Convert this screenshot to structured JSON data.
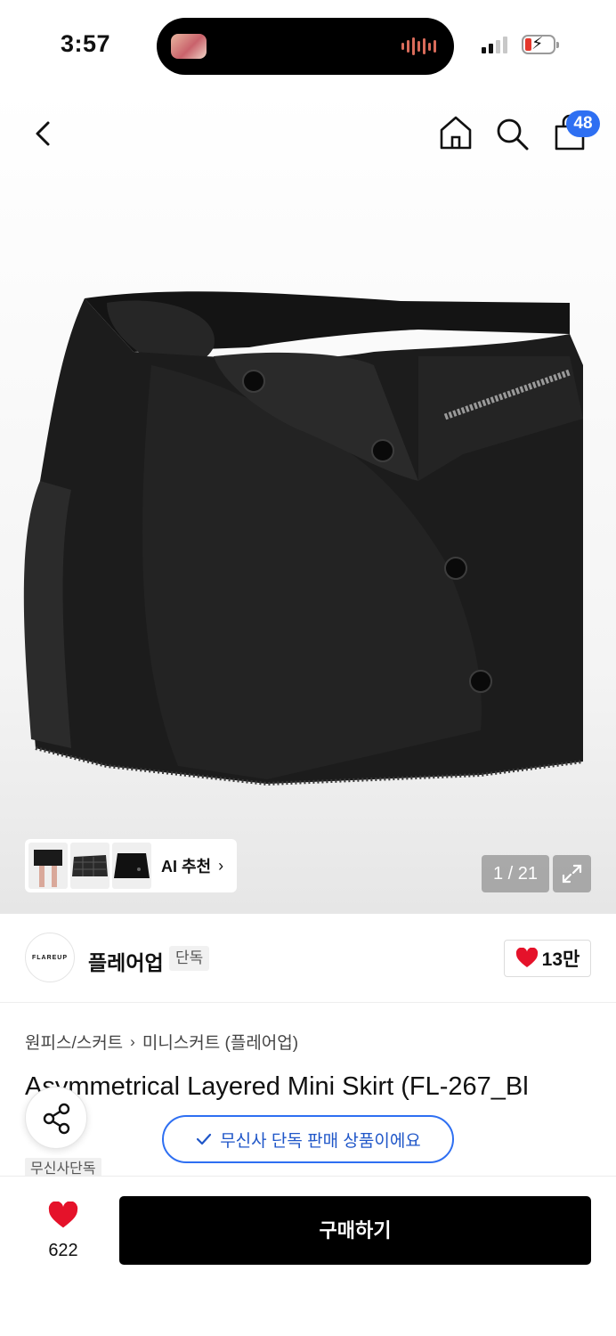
{
  "status_bar": {
    "time": "3:57"
  },
  "header": {
    "cart_count": "48"
  },
  "gallery": {
    "ai_recommend_label": "AI 추천",
    "counter": "1 / 21"
  },
  "brand": {
    "logo_text": "FLAREUP",
    "name": "플레어업",
    "exclusive_tag": "단독",
    "like_count": "13만"
  },
  "product": {
    "breadcrumb": [
      "원피스/스커트",
      "미니스커트 (플레어업)"
    ],
    "title": "Asymmetrical Layered Mini Skirt (FL-267_Bl",
    "exclusive_banner": "무신사 단독 판매 상품이에요",
    "tag": "무신사단독"
  },
  "bottom_bar": {
    "wish_count": "622",
    "buy_label": "구매하기"
  },
  "colors": {
    "accent_blue": "#2e6ff2",
    "heart_red": "#e5122a",
    "buy_black": "#000000"
  }
}
